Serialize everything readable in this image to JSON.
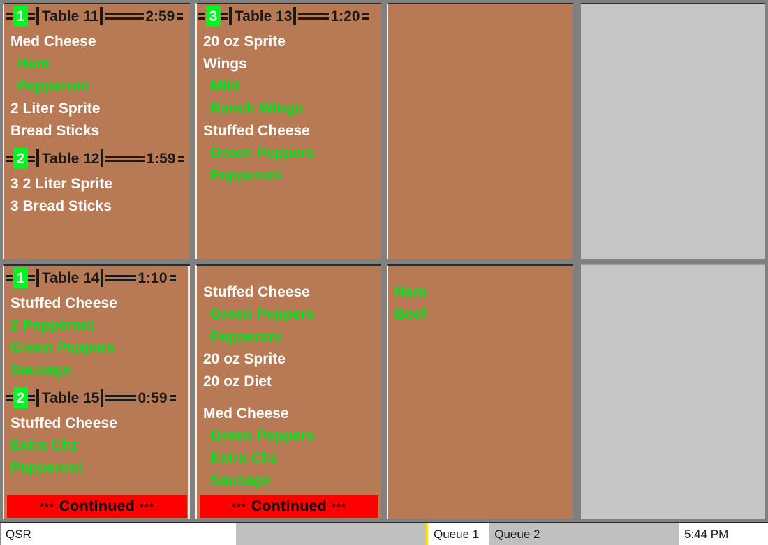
{
  "app": {
    "name": "QSR",
    "clock": "5:44 PM"
  },
  "status_bar": {
    "tabs": [
      {
        "label": "Queue 1",
        "active": true
      },
      {
        "label": "Queue 2",
        "active": false
      }
    ]
  },
  "colors": {
    "ticket_background": "#b87a55",
    "empty_panel": "#c6c6c6",
    "divider": "#808080",
    "sequence_badge": "#00f522",
    "product_text": "#ffffff",
    "modifier_text": "#00e61e",
    "continued_banner": "#ff0000",
    "active_tab_accent": "#ffe500"
  },
  "cells": [
    {
      "id": "cell-r1c1",
      "type": "orders",
      "continued": null,
      "orders": [
        {
          "sequence": "1",
          "label": "Table 11",
          "time": "2:59",
          "items": [
            {
              "text": "Med Cheese",
              "kind": "product"
            },
            {
              "text": "Ham",
              "kind": "modifier"
            },
            {
              "text": "Pepperoni",
              "kind": "modifier"
            },
            {
              "text": "2 Liter Sprite",
              "kind": "product"
            },
            {
              "text": "Bread Sticks",
              "kind": "product"
            }
          ]
        },
        {
          "sequence": "2",
          "label": "Table 12",
          "time": "1:59",
          "items": [
            {
              "text": "3 2 Liter Sprite",
              "kind": "product"
            },
            {
              "text": "3 Bread Sticks",
              "kind": "product"
            }
          ]
        }
      ]
    },
    {
      "id": "cell-r1c2",
      "type": "orders",
      "continued": null,
      "orders": [
        {
          "sequence": "3",
          "label": "Table 13",
          "time": "1:20",
          "items": [
            {
              "text": "20 oz Sprite",
              "kind": "product"
            },
            {
              "text": "Wings",
              "kind": "product"
            },
            {
              "text": "Mild",
              "kind": "modifier"
            },
            {
              "text": "Ranch Wings",
              "kind": "modifier"
            },
            {
              "text": "Stuffed Cheese",
              "kind": "product"
            },
            {
              "text": "Green Peppers",
              "kind": "modifier"
            },
            {
              "text": "Pepperoni",
              "kind": "modifier"
            }
          ]
        }
      ]
    },
    {
      "id": "cell-r1c3",
      "type": "orders",
      "continued": null,
      "orders": []
    },
    {
      "id": "cell-r1c4",
      "type": "empty",
      "orders": []
    },
    {
      "id": "cell-r2c1",
      "type": "orders",
      "continued": {
        "stars": "***",
        "text": "Continued"
      },
      "orders": [
        {
          "sequence": "1",
          "label": "Table 14",
          "time": "1:10",
          "items": [
            {
              "text": "Stuffed Cheese",
              "kind": "product"
            },
            {
              "text": "2 Pepperoni",
              "kind": "modifier"
            },
            {
              "text": "Green Peppers",
              "kind": "modifier"
            },
            {
              "text": "Sausage",
              "kind": "modifier"
            }
          ]
        },
        {
          "sequence": "2",
          "label": "Table 15",
          "time": "0:59",
          "items": [
            {
              "text": "Stuffed Cheese",
              "kind": "product"
            },
            {
              "text": "Extra Chz",
              "kind": "modifier"
            },
            {
              "text": "Pepperoni",
              "kind": "modifier"
            }
          ]
        }
      ]
    },
    {
      "id": "cell-r2c2",
      "type": "overflow",
      "continued": {
        "stars": "***",
        "text": "Continued"
      },
      "items": [
        {
          "text": "Stuffed Cheese",
          "kind": "product"
        },
        {
          "text": "Green Peppers",
          "kind": "modifier"
        },
        {
          "text": "Pepperoni",
          "kind": "modifier"
        },
        {
          "text": "20 oz Sprite",
          "kind": "product"
        },
        {
          "text": "20 oz Diet",
          "kind": "product"
        },
        {
          "text": "",
          "kind": "gap"
        },
        {
          "text": "Med Cheese",
          "kind": "product"
        },
        {
          "text": "Green Peppers",
          "kind": "modifier"
        },
        {
          "text": "Extra Chz",
          "kind": "modifier"
        },
        {
          "text": "Sausage",
          "kind": "modifier"
        }
      ]
    },
    {
      "id": "cell-r2c3",
      "type": "overflow",
      "continued": null,
      "items": [
        {
          "text": "Ham",
          "kind": "modifier",
          "flush": true
        },
        {
          "text": "Beef",
          "kind": "modifier",
          "flush": true
        }
      ]
    },
    {
      "id": "cell-r2c4",
      "type": "empty",
      "items": []
    }
  ]
}
